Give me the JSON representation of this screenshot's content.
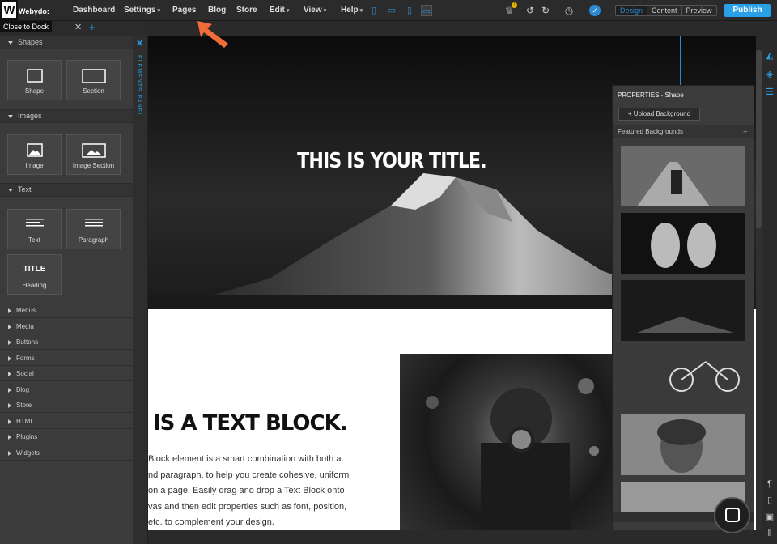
{
  "app": {
    "logo_letter": "W",
    "logo_text": "Webydo:"
  },
  "tooltip": "Close to Dock",
  "nav": {
    "dashboard": "Dashboard",
    "settings": "Settings",
    "pages": "Pages",
    "blog": "Blog",
    "store": "Store",
    "edit": "Edit",
    "view": "View",
    "help": "Help"
  },
  "modes": {
    "design": "Design",
    "content": "Content",
    "preview": "Preview",
    "active": "Design"
  },
  "publish_label": "Publish",
  "elements_panel": {
    "side_label": "ELEMENTS PANEL",
    "sections": [
      {
        "title": "Shapes",
        "items": [
          "Shape",
          "Section"
        ]
      },
      {
        "title": "Images",
        "items": [
          "Image",
          "Image Section"
        ]
      },
      {
        "title": "Text",
        "items": [
          "Text",
          "Paragraph",
          "Heading"
        ]
      }
    ],
    "heading_tile_glyph": "TITLE",
    "categories": [
      "Menus",
      "Media",
      "Buttons",
      "Forms",
      "Social",
      "Blog",
      "Store",
      "HTML",
      "Plugins",
      "Widgets"
    ]
  },
  "canvas": {
    "hero_title": "THIS IS YOUR TITLE.",
    "text_block_title": "IS A TEXT BLOCK.",
    "paragraph_lines": [
      "Block element is a smart combination with both a",
      "nd paragraph, to help you create cohesive, uniform",
      "on a page. Easily drag and drop a Text Block onto",
      "vas and then edit properties such as font, position,",
      "etc. to complement your design."
    ]
  },
  "properties": {
    "title": "PROPERTIES - Shape",
    "upload_label": "+ Upload Background",
    "featured_label": "Featured Backgrounds",
    "collapse_glyph": "–"
  },
  "colors": {
    "accent": "#2aa0e6",
    "publish": "#2aa0e6",
    "panel": "#3b3b3b",
    "arrow": "#f26b3a"
  }
}
